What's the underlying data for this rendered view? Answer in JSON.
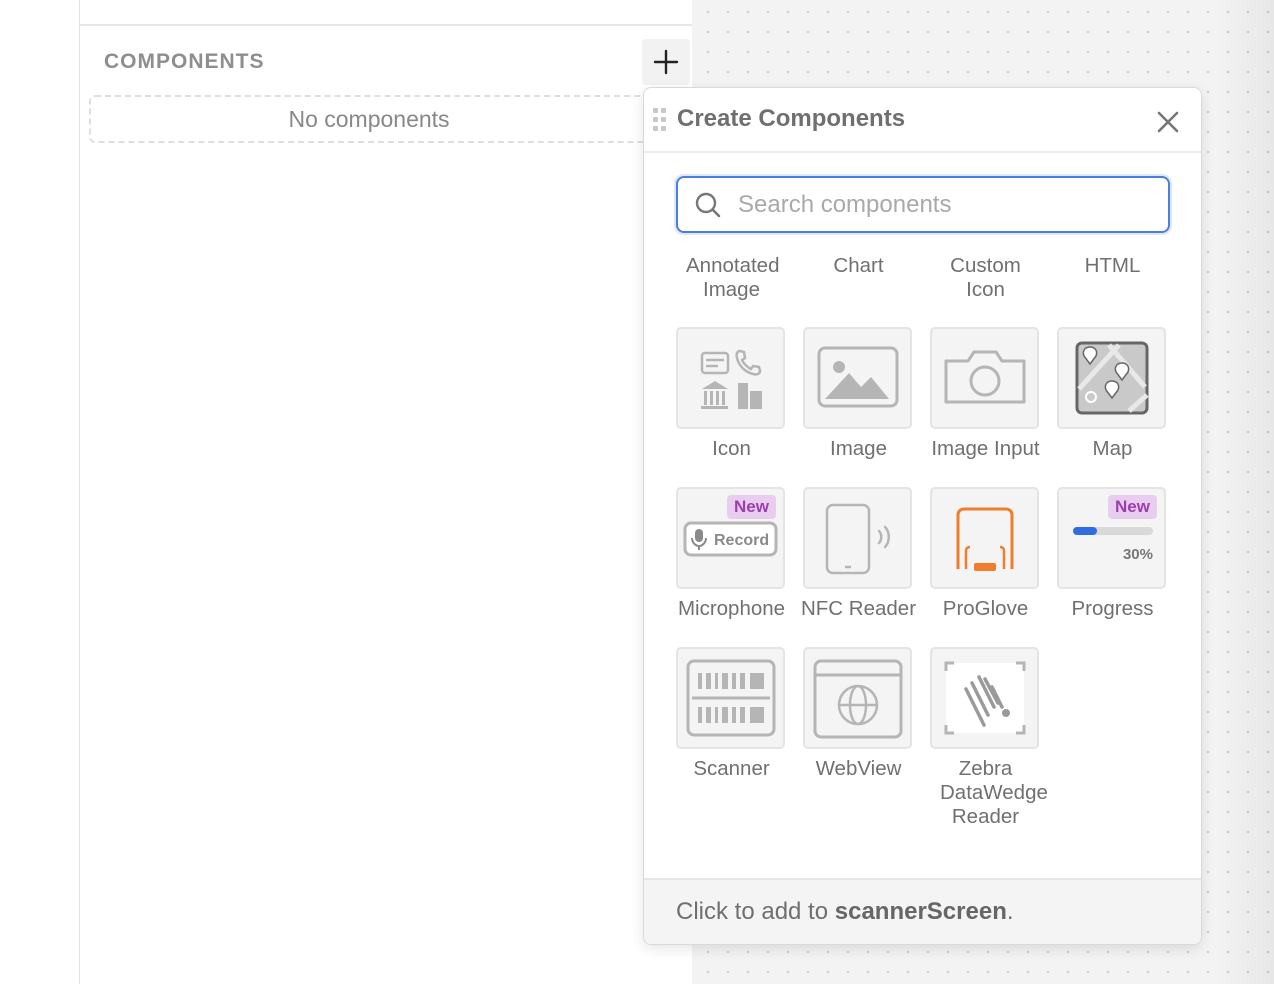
{
  "sidebar": {
    "section_title": "COMPONENTS",
    "empty_text": "No components",
    "add_icon": "plus-icon"
  },
  "dialog": {
    "title": "Create Components",
    "close_icon": "close-icon",
    "search_placeholder": "Search components",
    "text_items": [
      "Annotated Image",
      "Chart",
      "Custom Icon",
      "HTML"
    ],
    "items": [
      {
        "label": "Icon",
        "icon": "icon-collection-icon"
      },
      {
        "label": "Image",
        "icon": "image-icon"
      },
      {
        "label": "Image Input",
        "icon": "camera-icon"
      },
      {
        "label": "Map",
        "icon": "map-icon"
      },
      {
        "label": "Microphone",
        "icon": "microphone-icon",
        "badge": "New",
        "preview_text": "Record"
      },
      {
        "label": "NFC Reader",
        "icon": "nfc-icon"
      },
      {
        "label": "ProGlove",
        "icon": "proglove-icon"
      },
      {
        "label": "Progress",
        "icon": "progress-icon",
        "badge": "New",
        "preview_text": "30%",
        "progress_value": 0.3
      },
      {
        "label": "Scanner",
        "icon": "barcode-scanner-icon"
      },
      {
        "label": "WebView",
        "icon": "webview-icon"
      },
      {
        "label": "Zebra DataWedge Reader",
        "icon": "zebra-icon"
      }
    ],
    "footer_prefix": "Click to add to ",
    "footer_target": "scannerScreen",
    "footer_suffix": ".",
    "accent_color": "#4a7fe0",
    "badge_color": "#9b3eb0",
    "proglove_color": "#ef7d2b"
  }
}
